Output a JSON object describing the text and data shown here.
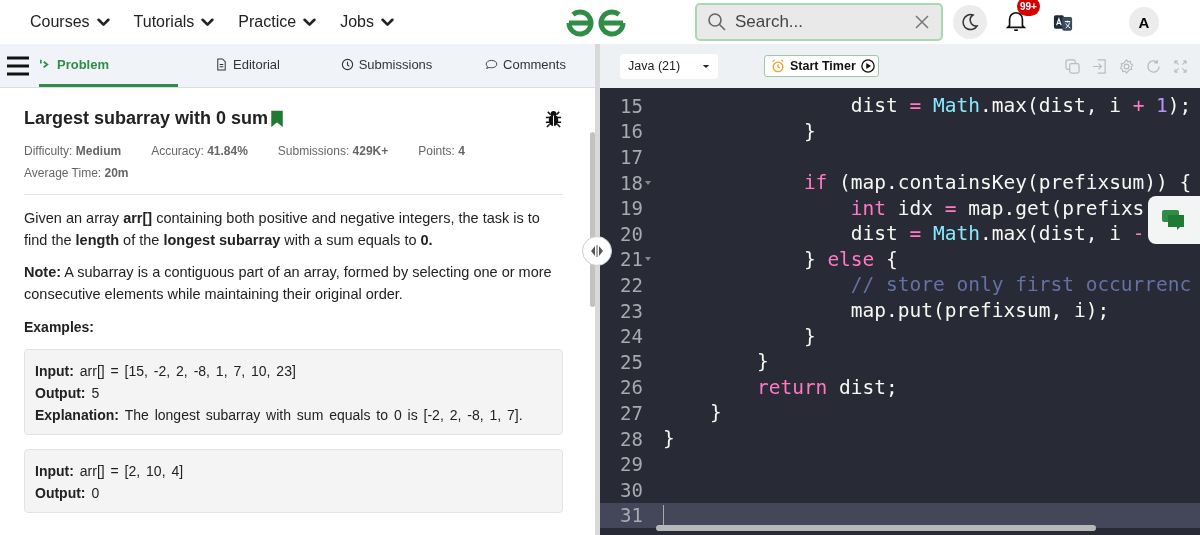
{
  "nav": {
    "menus": [
      {
        "label": "Courses"
      },
      {
        "label": "Tutorials"
      },
      {
        "label": "Practice"
      },
      {
        "label": "Jobs"
      }
    ],
    "search": {
      "placeholder": "Search..."
    },
    "notifications": {
      "badge": "99+"
    },
    "avatar": {
      "initial": "A"
    }
  },
  "tabs": [
    {
      "label": "Problem",
      "selected": true
    },
    {
      "label": "Editorial",
      "selected": false
    },
    {
      "label": "Submissions",
      "selected": false
    },
    {
      "label": "Comments",
      "selected": false
    }
  ],
  "problem": {
    "title": "Largest subarray with 0 sum",
    "bookmarked": true,
    "meta": [
      {
        "text": "Difficulty: **Medium**"
      },
      {
        "text": "Accuracy: **41.84%**"
      },
      {
        "text": "Submissions: **429K+**"
      },
      {
        "text": "Points: **4**"
      },
      {
        "text": "Average Time: **20m**"
      }
    ],
    "paragraphs": [
      "Given an array **arr[]** containing both positive and negative integers, the task is to find the **length** of the **longest subarray** with a sum equals to **0.**",
      "**Note:** A subarray is a contiguous part of an array, formed by selecting one or more consecutive elements while maintaining their original order."
    ],
    "examples_heading": "Examples:",
    "examples": [
      {
        "lines": [
          "**Input:** arr[] = [15, -2, 2, -8, 1, 7, 10, 23]",
          "**Output:** 5",
          "**Explanation:** The longest subarray with sum equals to 0 is [-2, 2, -8, 1, 7]."
        ]
      },
      {
        "lines": [
          "**Input:** arr[] = [2, 10, 4]",
          "**Output:** 0"
        ]
      }
    ]
  },
  "editor": {
    "language": "Java (21)",
    "timer_button": "Start Timer",
    "lines": [
      {
        "number": "15",
        "fold": false,
        "current": false,
        "tokens": [
          {
            "kind": "plain",
            "text": "                dist "
          },
          {
            "kind": "op",
            "text": "= "
          },
          {
            "kind": "class",
            "text": "Math"
          },
          {
            "kind": "plain",
            "text": ".max(dist, i "
          },
          {
            "kind": "op",
            "text": "+ "
          },
          {
            "kind": "number",
            "text": "1"
          },
          {
            "kind": "plain",
            "text": ");"
          }
        ]
      },
      {
        "number": "16",
        "fold": false,
        "current": false,
        "tokens": [
          {
            "kind": "plain",
            "text": "            }"
          }
        ]
      },
      {
        "number": "17",
        "fold": false,
        "current": false
      },
      {
        "number": "18",
        "fold": true,
        "current": false,
        "tokens": [
          {
            "kind": "keyword",
            "text": "            if"
          },
          {
            "kind": "plain",
            "text": " (map.containsKey(prefixsum)) {"
          }
        ]
      },
      {
        "number": "19",
        "fold": false,
        "current": false,
        "tokens": [
          {
            "kind": "keyword",
            "text": "                int"
          },
          {
            "kind": "plain",
            "text": " idx "
          },
          {
            "kind": "op",
            "text": "="
          },
          {
            "kind": "plain",
            "text": " map.get(prefixs"
          }
        ]
      },
      {
        "number": "20",
        "fold": false,
        "current": false,
        "tokens": [
          {
            "kind": "plain",
            "text": "                dist "
          },
          {
            "kind": "op",
            "text": "= "
          },
          {
            "kind": "class",
            "text": "Math"
          },
          {
            "kind": "plain",
            "text": ".max(dist, i "
          },
          {
            "kind": "op",
            "text": "-"
          }
        ]
      },
      {
        "number": "21",
        "fold": true,
        "current": false,
        "tokens": [
          {
            "kind": "plain",
            "text": "            } "
          },
          {
            "kind": "keyword",
            "text": "else"
          },
          {
            "kind": "plain",
            "text": " {"
          }
        ]
      },
      {
        "number": "22",
        "fold": false,
        "current": false,
        "tokens": [
          {
            "kind": "comment",
            "text": "                // store only first occurrenc"
          }
        ]
      },
      {
        "number": "23",
        "fold": false,
        "current": false,
        "tokens": [
          {
            "kind": "plain",
            "text": "                map.put(prefixsum, i);"
          }
        ]
      },
      {
        "number": "24",
        "fold": false,
        "current": false,
        "tokens": [
          {
            "kind": "plain",
            "text": "            }"
          }
        ]
      },
      {
        "number": "25",
        "fold": false,
        "current": false,
        "tokens": [
          {
            "kind": "plain",
            "text": "        }"
          }
        ]
      },
      {
        "number": "26",
        "fold": false,
        "current": false,
        "tokens": [
          {
            "kind": "keyword",
            "text": "        return"
          },
          {
            "kind": "plain",
            "text": " dist;"
          }
        ]
      },
      {
        "number": "27",
        "fold": false,
        "current": false,
        "tokens": [
          {
            "kind": "plain",
            "text": "    }"
          }
        ]
      },
      {
        "number": "28",
        "fold": false,
        "current": false,
        "tokens": [
          {
            "kind": "plain",
            "text": "}"
          }
        ]
      },
      {
        "number": "29",
        "fold": false,
        "current": false
      },
      {
        "number": "30",
        "fold": false,
        "current": false
      },
      {
        "number": "31",
        "fold": false,
        "current": true
      }
    ]
  }
}
